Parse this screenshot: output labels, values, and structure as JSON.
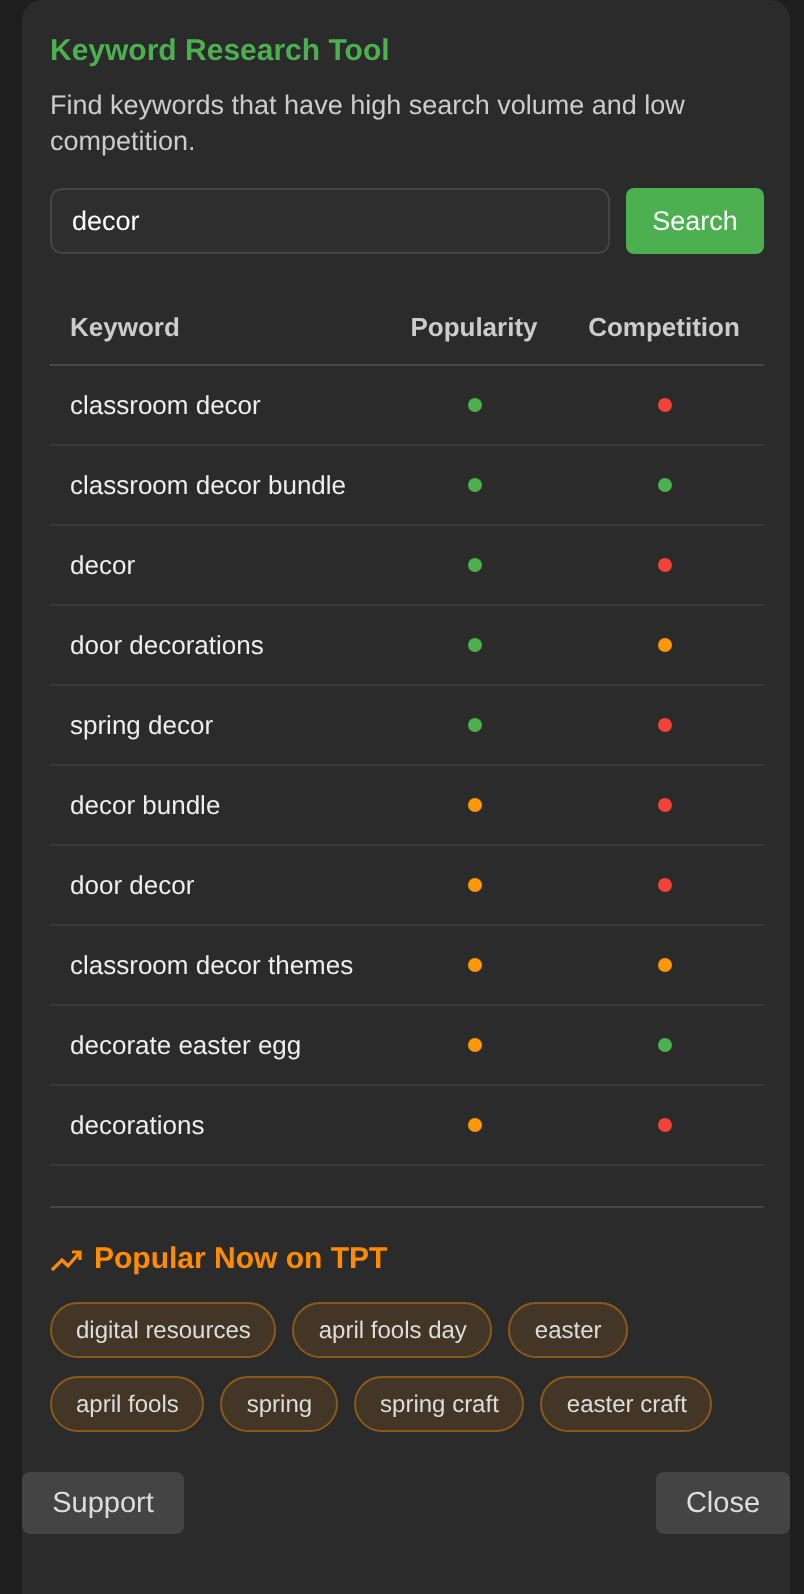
{
  "title": "Keyword Research Tool",
  "description": "Find keywords that have high search volume and low competition.",
  "search": {
    "value": "decor",
    "button": "Search"
  },
  "table": {
    "columns": [
      "Keyword",
      "Popularity",
      "Competition"
    ],
    "rows": [
      {
        "keyword": "classroom decor",
        "popularity": {
          "color": "#4caf50"
        },
        "competition": {
          "color": "#f44336"
        }
      },
      {
        "keyword": "classroom decor bundle",
        "popularity": {
          "color": "#4caf50"
        },
        "competition": {
          "color": "#4caf50"
        }
      },
      {
        "keyword": "decor",
        "popularity": {
          "color": "#4caf50"
        },
        "competition": {
          "color": "#f44336"
        }
      },
      {
        "keyword": "door decorations",
        "popularity": {
          "color": "#4caf50"
        },
        "competition": {
          "color": "#ff9800"
        }
      },
      {
        "keyword": "spring decor",
        "popularity": {
          "color": "#4caf50"
        },
        "competition": {
          "color": "#f44336"
        }
      },
      {
        "keyword": "decor bundle",
        "popularity": {
          "color": "#ff9800"
        },
        "competition": {
          "color": "#f44336"
        }
      },
      {
        "keyword": "door decor",
        "popularity": {
          "color": "#ff9800"
        },
        "competition": {
          "color": "#f44336"
        }
      },
      {
        "keyword": "classroom decor themes",
        "popularity": {
          "color": "#ff9800"
        },
        "competition": {
          "color": "#ff9800"
        }
      },
      {
        "keyword": "decorate easter egg",
        "popularity": {
          "color": "#ff9800"
        },
        "competition": {
          "color": "#4caf50"
        }
      },
      {
        "keyword": "decorations",
        "popularity": {
          "color": "#ff9800"
        },
        "competition": {
          "color": "#f44336"
        }
      }
    ]
  },
  "popular": {
    "title": "Popular Now on TPT",
    "tags": [
      "digital resources",
      "april fools day",
      "easter",
      "april fools",
      "spring",
      "spring craft",
      "easter craft"
    ]
  },
  "overlay_buttons": [
    "Support",
    "Close"
  ]
}
